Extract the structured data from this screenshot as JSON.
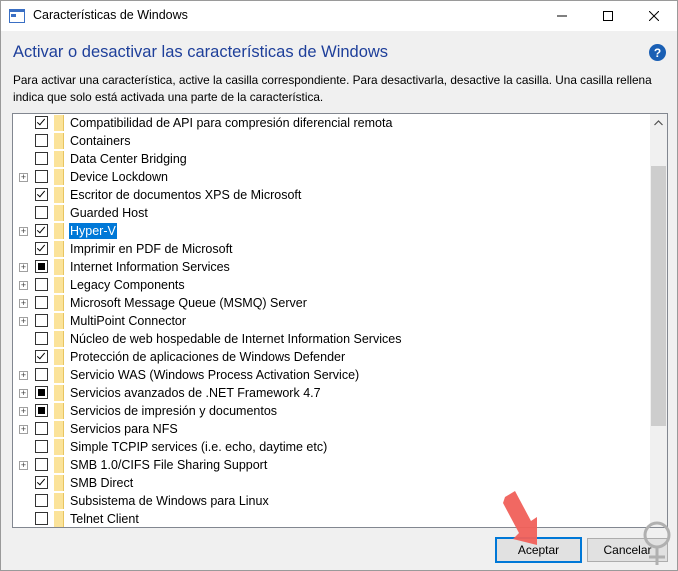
{
  "window": {
    "title": "Características de Windows",
    "minimize_glyph": "—",
    "close_glyph": "✕"
  },
  "header": {
    "heading": "Activar o desactivar las características de Windows",
    "help_glyph": "?",
    "description": "Para activar una característica, active la casilla correspondiente. Para desactivarla, desactive la casilla. Una casilla rellena indica que solo está activada una parte de la característica."
  },
  "features": [
    {
      "label": "Compatibilidad de API para compresión diferencial remota",
      "state": "checked",
      "expandable": false
    },
    {
      "label": "Containers",
      "state": "unchecked",
      "expandable": false
    },
    {
      "label": "Data Center Bridging",
      "state": "unchecked",
      "expandable": false
    },
    {
      "label": "Device Lockdown",
      "state": "unchecked",
      "expandable": true
    },
    {
      "label": "Escritor de documentos XPS de Microsoft",
      "state": "checked",
      "expandable": false
    },
    {
      "label": "Guarded Host",
      "state": "unchecked",
      "expandable": false
    },
    {
      "label": "Hyper-V",
      "state": "checked",
      "expandable": true,
      "selected": true
    },
    {
      "label": "Imprimir en PDF de Microsoft",
      "state": "checked",
      "expandable": false
    },
    {
      "label": "Internet Information Services",
      "state": "partial",
      "expandable": true
    },
    {
      "label": "Legacy Components",
      "state": "unchecked",
      "expandable": true
    },
    {
      "label": "Microsoft Message Queue (MSMQ) Server",
      "state": "unchecked",
      "expandable": true
    },
    {
      "label": "MultiPoint Connector",
      "state": "unchecked",
      "expandable": true
    },
    {
      "label": "Núcleo de web hospedable de Internet Information Services",
      "state": "unchecked",
      "expandable": false
    },
    {
      "label": "Protección de aplicaciones de Windows Defender",
      "state": "checked",
      "expandable": false
    },
    {
      "label": "Servicio WAS (Windows Process Activation Service)",
      "state": "unchecked",
      "expandable": true
    },
    {
      "label": "Servicios avanzados de .NET Framework 4.7",
      "state": "partial",
      "expandable": true
    },
    {
      "label": "Servicios de impresión y documentos",
      "state": "partial",
      "expandable": true
    },
    {
      "label": "Servicios para NFS",
      "state": "unchecked",
      "expandable": true
    },
    {
      "label": "Simple TCPIP services (i.e. echo, daytime etc)",
      "state": "unchecked",
      "expandable": false
    },
    {
      "label": "SMB 1.0/CIFS File Sharing Support",
      "state": "unchecked",
      "expandable": true
    },
    {
      "label": "SMB Direct",
      "state": "checked",
      "expandable": false
    },
    {
      "label": "Subsistema de Windows para Linux",
      "state": "unchecked",
      "expandable": false
    },
    {
      "label": "Telnet Client",
      "state": "unchecked",
      "expandable": false
    }
  ],
  "buttons": {
    "ok": "Aceptar",
    "cancel": "Cancelar"
  },
  "colors": {
    "heading": "#1e3f9a",
    "selection": "#0078d7",
    "folder": "#fbe39a",
    "arrow": "#f0605a"
  }
}
